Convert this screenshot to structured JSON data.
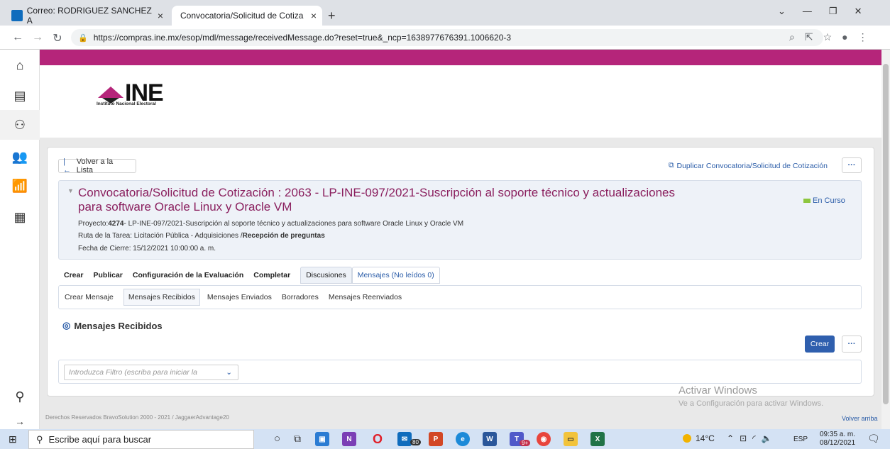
{
  "browser": {
    "tabs": [
      {
        "label": "Correo: RODRIGUEZ SANCHEZ A",
        "fav_color": "#0f6cbd"
      },
      {
        "label": "Convocatoria/Solicitud de Cotiza",
        "fav_color": "#b5257a"
      }
    ],
    "close_glyph": "×",
    "new_tab_glyph": "+",
    "url": "https://compras.ine.mx/esop/mdl/message/receivedMessage.do?reset=true&_ncp=1638977676391.1006620-3",
    "window_controls": [
      "⌄",
      "—",
      "❐",
      "✕"
    ]
  },
  "logo": {
    "text": "INE",
    "subtitle": "Instituto Nacional Electoral",
    "color": "#b5257a"
  },
  "toolbar": {
    "back_label": "Volver a la Lista",
    "duplicate_label": "Duplicar Convocatoria/Solicitud de Cotización",
    "more_label": "···"
  },
  "header": {
    "title_line1": "Convocatoria/Solicitud de Cotización : 2063 - LP-INE-097/2021-Suscripción al soporte técnico y actualizaciones",
    "title_line2": "para software Oracle Linux y Oracle VM",
    "status": "En Curso",
    "status_color": "#8dc63f",
    "proyecto_label": "Proyecto:",
    "proyecto_num": "4274",
    "proyecto_text": "- LP-INE-097/2021-Suscripción al soporte técnico y actualizaciones para software Oracle Linux y Oracle VM",
    "ruta_label": "Ruta de la Tarea: Licitación Pública - Adquisiciones /",
    "ruta_bold": "Recepción de preguntas",
    "fecha": "Fecha de Cierre: 15/12/2021 10:00:00 a. m."
  },
  "main_tabs": [
    "Crear",
    "Publicar",
    "Configuración de la Evaluación",
    "Completar",
    "Discusiones",
    "Mensajes (No leídos 0)"
  ],
  "sub_tabs": [
    "Crear Mensaje",
    "Mensajes Recibidos",
    "Mensajes Enviados",
    "Borradores",
    "Mensajes Reenviados"
  ],
  "section": {
    "title": "Mensajes Recibidos",
    "create_label": "Crear",
    "more_label": "···",
    "filter_placeholder": "Introduzca Filtro (escriba para iniciar la"
  },
  "footer": {
    "copyright": "Derechos Reservados BravoSolution 2000 - 2021 / JaggaerAdvantage20",
    "back_top": "Volver arriba"
  },
  "watermark": {
    "line1": "Activar Windows",
    "line2": "Ve a Configuración para activar Windows."
  },
  "taskbar": {
    "search_placeholder": "Escribe aquí para buscar",
    "badge_mail": "80",
    "badge_teams": "9+",
    "weather": "14°C",
    "lang": "ESP",
    "time": "09:35 a. m.",
    "date": "08/12/2021"
  }
}
